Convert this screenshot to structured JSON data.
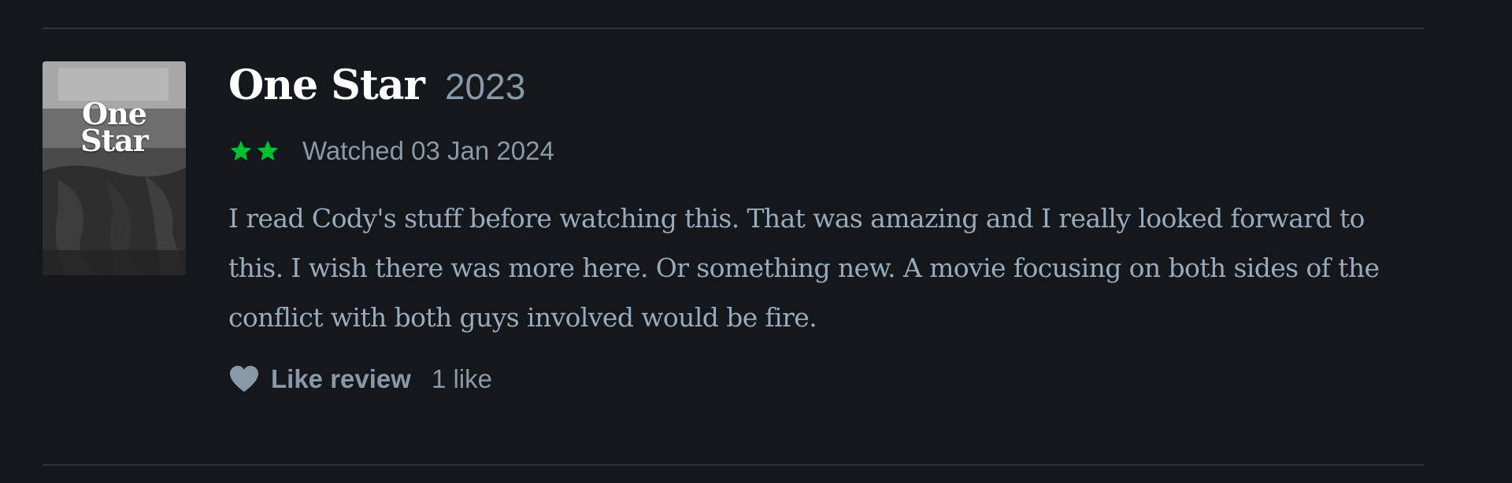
{
  "review": {
    "poster": {
      "title_text": "One\nStar"
    },
    "film": {
      "title": "One Star",
      "year": "2023"
    },
    "rating": {
      "stars": 2,
      "star_color": "#00c030"
    },
    "watched": "Watched 03 Jan 2024",
    "body": "I read Cody's stuff before watching this. That was amazing and I really looked forward to this. I wish there was more here. Or something new. A movie focusing on both sides of the conflict with both guys involved would be fire.",
    "actions": {
      "like_label": "Like review",
      "like_count": "1 like",
      "icon": "heart-icon"
    }
  }
}
